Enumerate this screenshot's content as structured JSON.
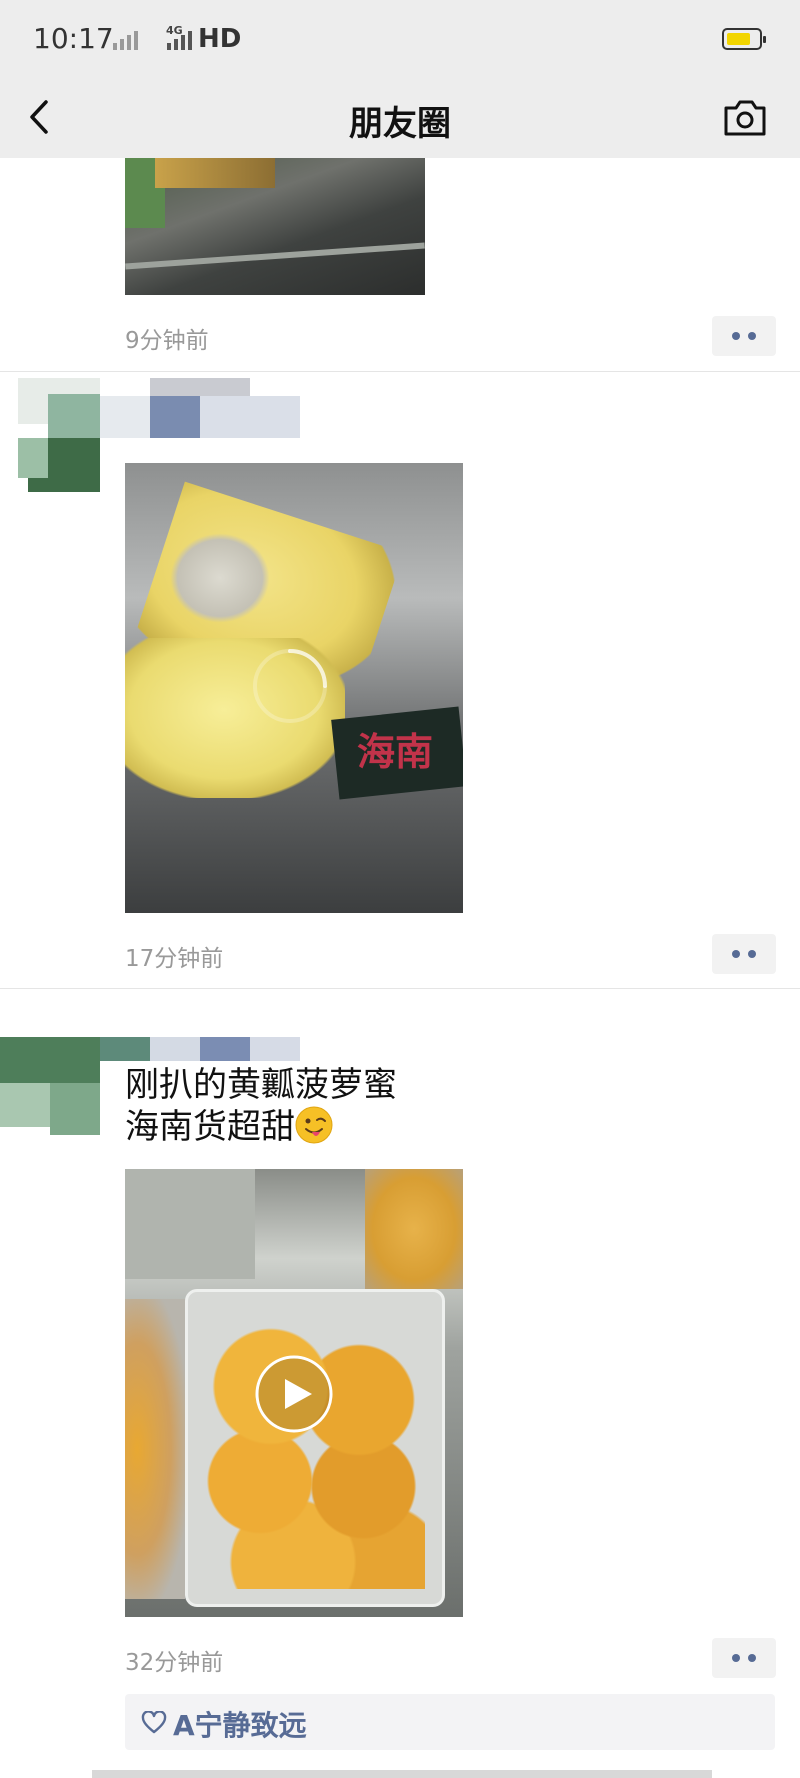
{
  "status_bar": {
    "time": "10:17",
    "network": "HD",
    "net_type": "4G",
    "battery_level": 0.75,
    "battery_color": "#f2d500"
  },
  "nav": {
    "title": "朋友圈",
    "back_icon": "chevron-left-icon",
    "camera_icon": "camera-icon"
  },
  "posts": [
    {
      "timestamp": "9分钟前",
      "more_icon": "ellipsis-icon"
    },
    {
      "timestamp": "17分钟前",
      "more_icon": "ellipsis-icon",
      "watermark": "海南"
    },
    {
      "text_line1": "刚扒的黄瓤菠萝蜜",
      "text_line2": "海南货超甜",
      "emoji": "winking-tongue-emoji",
      "timestamp": "32分钟前",
      "more_icon": "ellipsis-icon",
      "media": "video",
      "likes": [
        {
          "name": "A宁静致远"
        }
      ]
    }
  ],
  "colors": {
    "link": "#576b95",
    "bar_bg": "#ededed",
    "timestamp": "#999999"
  }
}
